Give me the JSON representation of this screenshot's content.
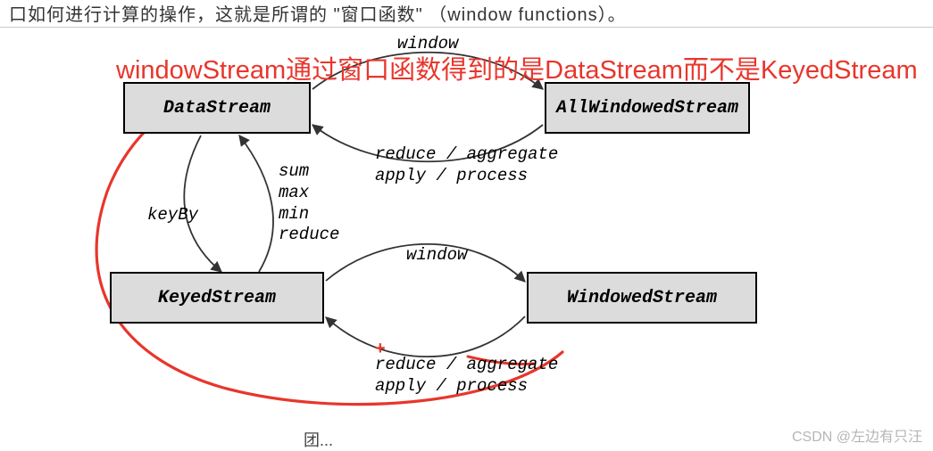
{
  "top_fragment": "口如何进行计算的操作，这就是所谓的 \"窗口函数\" （window functions）。",
  "red_annotation": "windowStream通过窗口函数得到的是DataStream而不是KeyedStream",
  "nodes": {
    "datastream": "DataStream",
    "allwindowed": "AllWindowedStream",
    "keyed": "KeyedStream",
    "windowed": "WindowedStream"
  },
  "labels": {
    "window1": "window",
    "reduce1": "reduce / aggregate\napply / process",
    "keyby": "keyBy",
    "summax": "sum\nmax\nmin\nreduce",
    "window2": "window",
    "reduce2": "reduce / aggregate\napply / process"
  },
  "plus": "+",
  "watermark": "CSDN @左边有只汪",
  "caption_fragment": "团...",
  "chart_data": {
    "type": "diagram",
    "title": "Flink stream transformations",
    "nodes": [
      "DataStream",
      "AllWindowedStream",
      "KeyedStream",
      "WindowedStream"
    ],
    "edges": [
      {
        "from": "DataStream",
        "to": "AllWindowedStream",
        "label": "window"
      },
      {
        "from": "AllWindowedStream",
        "to": "DataStream",
        "label": "reduce / aggregate / apply / process"
      },
      {
        "from": "DataStream",
        "to": "KeyedStream",
        "label": "keyBy"
      },
      {
        "from": "KeyedStream",
        "to": "DataStream",
        "label": "sum / max / min / reduce"
      },
      {
        "from": "KeyedStream",
        "to": "WindowedStream",
        "label": "window"
      },
      {
        "from": "WindowedStream",
        "to": "KeyedStream",
        "label": "reduce / aggregate / apply / process",
        "strikethrough": true
      },
      {
        "from": "WindowedStream",
        "to": "DataStream",
        "label": "",
        "hand_drawn": true,
        "color": "red"
      }
    ],
    "annotation": "windowStream通过窗口函数得到的是DataStream而不是KeyedStream"
  }
}
